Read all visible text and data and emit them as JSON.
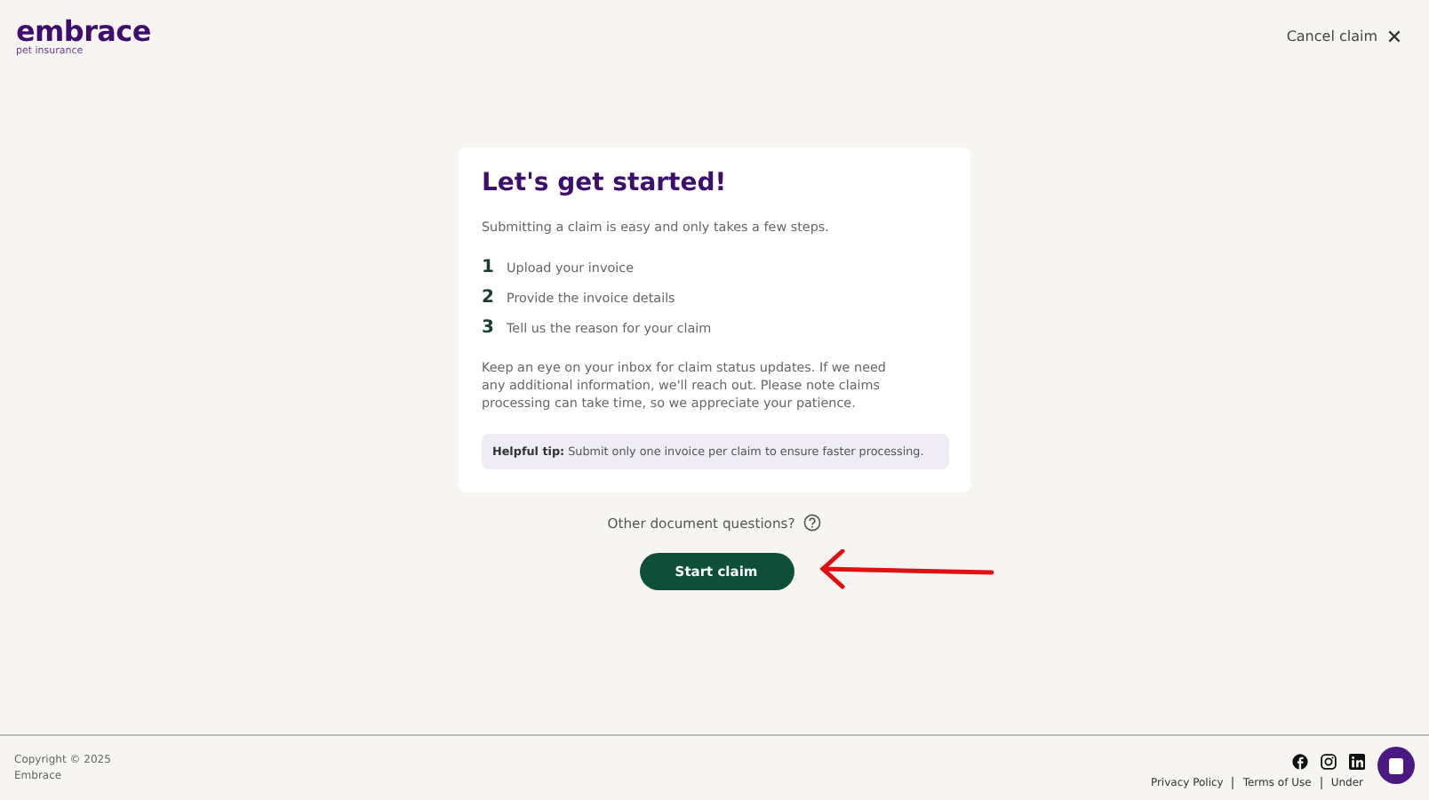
{
  "header": {
    "logo": "embrace",
    "logo_subtitle": "pet insurance",
    "cancel": "Cancel claim"
  },
  "card": {
    "title": "Let's get started!",
    "intro": "Submitting a claim is easy and only takes a few steps.",
    "steps": [
      {
        "number": "1",
        "text": "Upload your invoice"
      },
      {
        "number": "2",
        "text": "Provide the invoice details"
      },
      {
        "number": "3",
        "text": "Tell us the reason for your claim"
      }
    ],
    "note": "Keep an eye on your inbox for claim status updates. If we need any additional information, we'll reach out. Please note claims processing can take time, so we appreciate your patience.",
    "tip": "**Helpful tip:** Submit only one invoice per claim to ensure faster processing."
  },
  "questions": "Other document questions?",
  "start_button": "Start claim",
  "footer": {
    "copyright": "Copyright © 2025",
    "company": "Embrace",
    "links": [
      "Privacy Policy",
      "Terms of Use",
      "Under"
    ]
  }
}
